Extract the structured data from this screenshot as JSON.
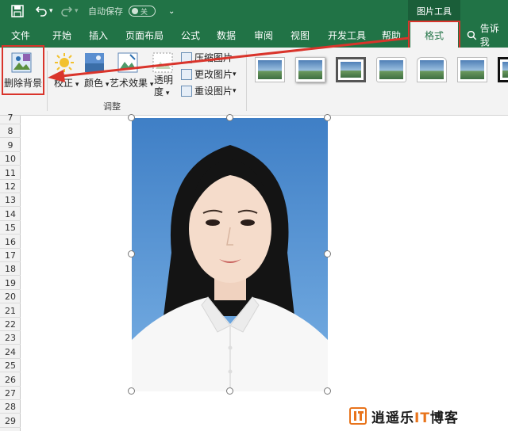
{
  "titlebar": {
    "autosave_label": "自动保存",
    "autosave_state": "关",
    "context_title": "图片工具"
  },
  "tabs": [
    {
      "label": "文件"
    },
    {
      "label": "开始"
    },
    {
      "label": "插入"
    },
    {
      "label": "页面布局"
    },
    {
      "label": "公式"
    },
    {
      "label": "数据"
    },
    {
      "label": "审阅"
    },
    {
      "label": "视图"
    },
    {
      "label": "开发工具"
    },
    {
      "label": "帮助"
    }
  ],
  "active_tab": "格式",
  "tell_me": "告诉我",
  "ribbon": {
    "remove_bg": "删除背景",
    "correct": "校正",
    "color": "颜色",
    "art_effect": "艺术效果",
    "transparency_1": "透明",
    "transparency_2": "度",
    "compress": "压缩图片",
    "change": "更改图片",
    "reset": "重设图片",
    "group_label": "调整"
  },
  "rows": [
    "7",
    "8",
    "9",
    "10",
    "11",
    "12",
    "13",
    "14",
    "15",
    "16",
    "17",
    "18",
    "19",
    "20",
    "21",
    "22",
    "23",
    "24",
    "25",
    "26",
    "27",
    "28",
    "29"
  ],
  "watermark": {
    "main": "逍遥乐",
    "it": "IT",
    "tail": "博客"
  },
  "colors": {
    "accent": "#217346",
    "highlight": "#d9342b"
  }
}
